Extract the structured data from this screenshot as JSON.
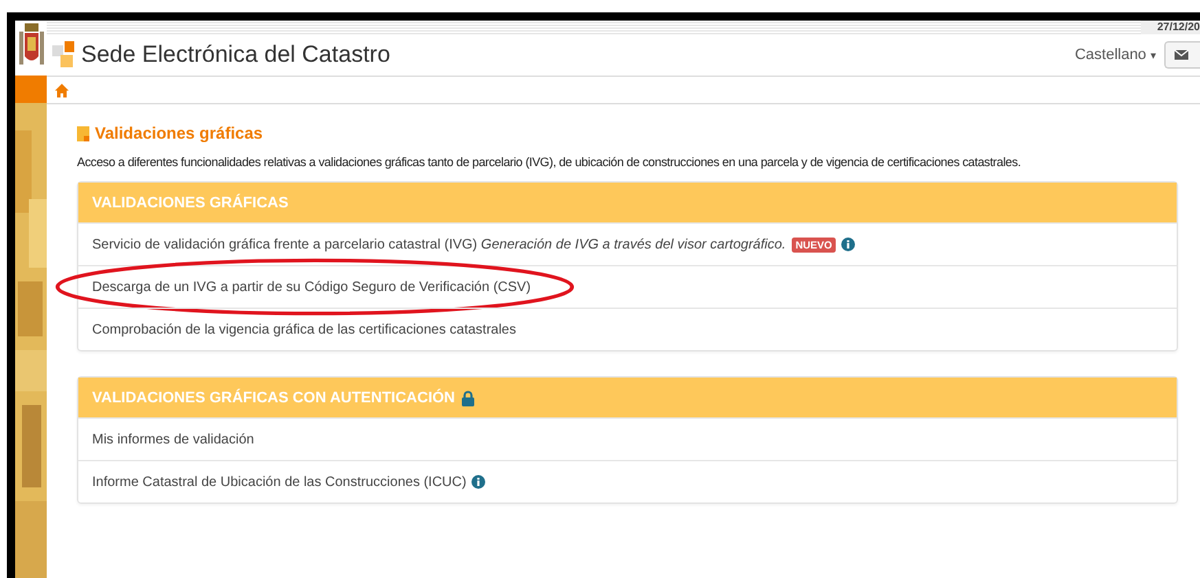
{
  "top_bar": {
    "date": "27/12/20"
  },
  "header": {
    "title": "Sede Electrónica del Catastro",
    "language": "Castellano",
    "caret": "▾"
  },
  "page": {
    "title": "Validaciones gráficas",
    "description": "Acceso a diferentes funcionalidades relativas a validaciones gráficas tanto de parcelario (IVG), de ubicación de construcciones en una parcela y de vigencia de certificaciones catastrales."
  },
  "panels": [
    {
      "title": "VALIDACIONES GRÁFICAS",
      "locked": false,
      "items": [
        {
          "text": "Servicio de validación gráfica frente a parcelario catastral (IVG)",
          "note": "Generación de IVG a través del visor cartográfico.",
          "badge": "NUEVO",
          "info": true,
          "circled": false
        },
        {
          "text": "Descarga de un IVG a partir de su Código Seguro de Verificación (CSV)",
          "info": false,
          "circled": true
        },
        {
          "text": "Comprobación de la vigencia gráfica de las certificaciones catastrales",
          "info": false,
          "circled": false
        }
      ]
    },
    {
      "title": "VALIDACIONES GRÁFICAS CON AUTENTICACIÓN",
      "locked": true,
      "items": [
        {
          "text": "Mis informes de validación",
          "info": false,
          "circled": false
        },
        {
          "text": "Informe Catastral de Ubicación de las Construcciones (ICUC)",
          "info": true,
          "circled": false
        }
      ]
    }
  ]
}
